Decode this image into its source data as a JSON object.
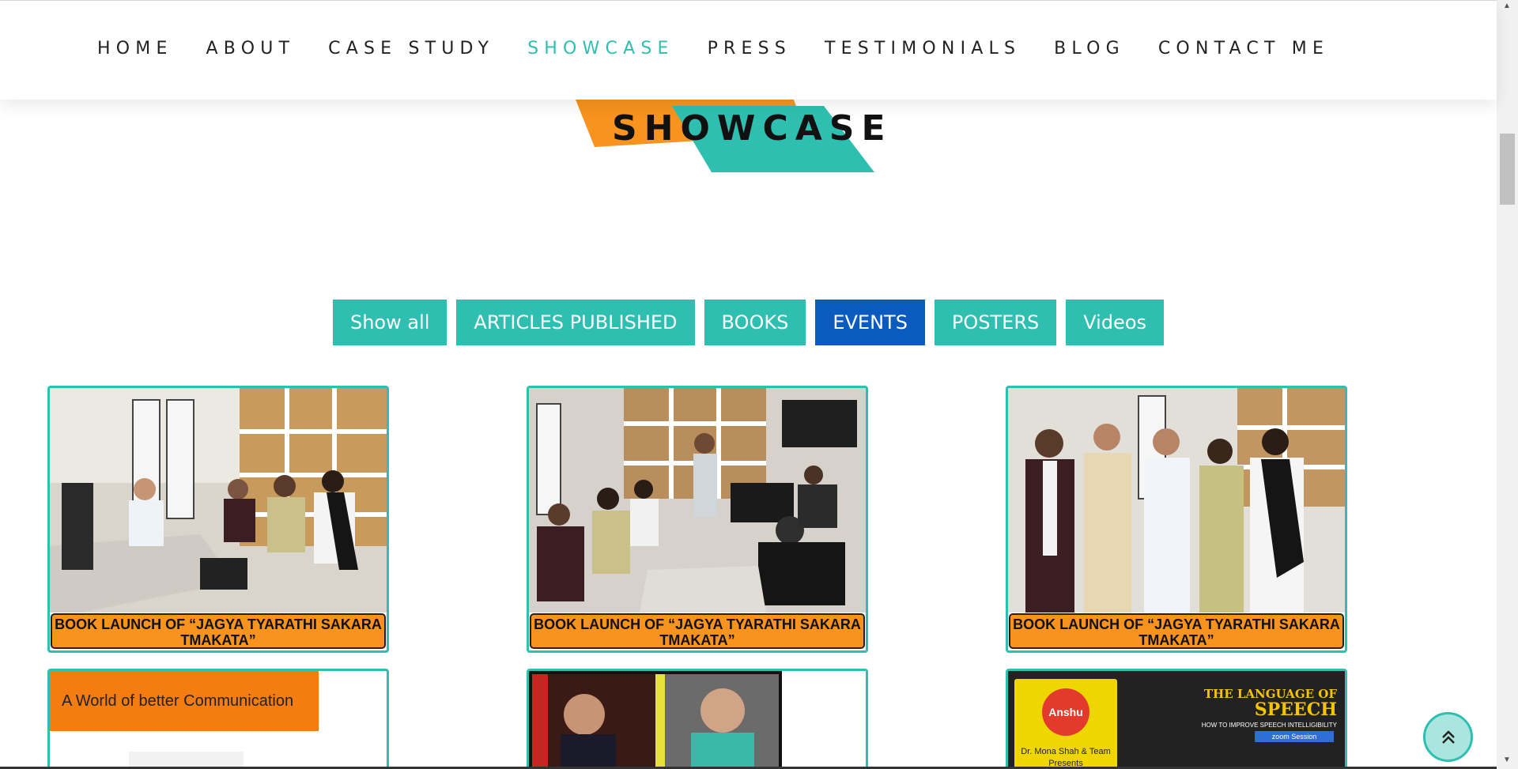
{
  "nav": {
    "items": [
      {
        "label": "HOME"
      },
      {
        "label": "ABOUT"
      },
      {
        "label": "CASE STUDY"
      },
      {
        "label": "SHOWCASE"
      },
      {
        "label": "PRESS"
      },
      {
        "label": "TESTIMONIALS"
      },
      {
        "label": "BLOG"
      },
      {
        "label": "CONTACT ME"
      }
    ],
    "active": "SHOWCASE"
  },
  "heading": {
    "title": "SHOWCASE"
  },
  "filters": {
    "items": [
      {
        "label": "Show all"
      },
      {
        "label": "ARTICLES PUBLISHED"
      },
      {
        "label": "BOOKS"
      },
      {
        "label": "EVENTS"
      },
      {
        "label": "POSTERS"
      },
      {
        "label": "Videos"
      }
    ],
    "active": "EVENTS"
  },
  "cards": [
    {
      "caption": "BOOK LAUNCH OF “JAGYA TYARATHI SAKARA TMAKATA”"
    },
    {
      "caption": "BOOK LAUNCH OF “JAGYA TYARATHI SAKARA TMAKATA”"
    },
    {
      "caption": "BOOK LAUNCH OF “JAGYA TYARATHI SAKARA TMAKATA”"
    }
  ],
  "posters": {
    "communication_banner": "A World of better Communication",
    "speech_title_line1": "THE LANGUAGE OF",
    "speech_title_line2": "SPEECH",
    "speech_subtitle": "HOW TO IMPROVE SPEECH INTELLIGIBILITY",
    "speech_zoom": "zoom Session",
    "speech_logo": "Anshu",
    "speech_presenter": "Dr. Mona Shah & Team",
    "speech_presents": "Presents"
  },
  "colors": {
    "teal": "#2fbfb0",
    "orange": "#f7931e",
    "active_blue": "#0b5bbf"
  },
  "icons": {
    "back_to_top": "double-chevron-up-icon"
  }
}
